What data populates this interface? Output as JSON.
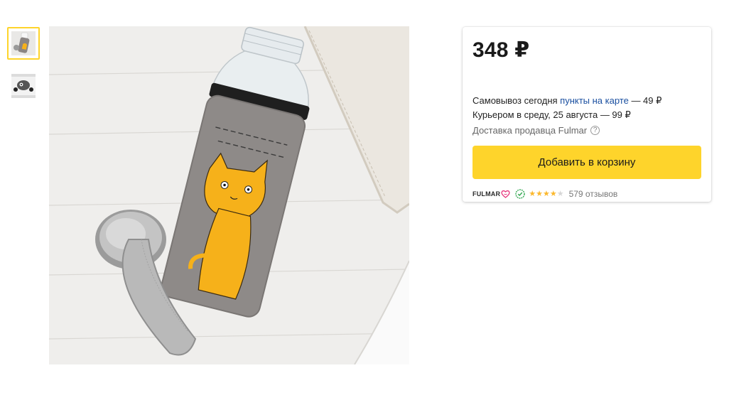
{
  "product": {
    "price": "348 ₽"
  },
  "delivery": {
    "pickup_prefix": "Самовывоз сегодня ",
    "pickup_link": "пункты на карте",
    "pickup_price": " — 49 ₽",
    "courier": "Курьером в среду, 25 августа — 99 ₽",
    "seller_delivery": "Доставка продавца Fulmar",
    "help_icon": "?"
  },
  "cart": {
    "add_label": "Добавить в корзину"
  },
  "seller": {
    "logo_text": "FULMAR",
    "rating": 4,
    "rating_max": 5,
    "reviews": "579 отзывов"
  },
  "gallery": {
    "thumbnail_count": 2,
    "active_index": 0
  },
  "colors": {
    "accent": "#fed42b",
    "link": "#1a4fa0",
    "star": "#fbb82d"
  }
}
